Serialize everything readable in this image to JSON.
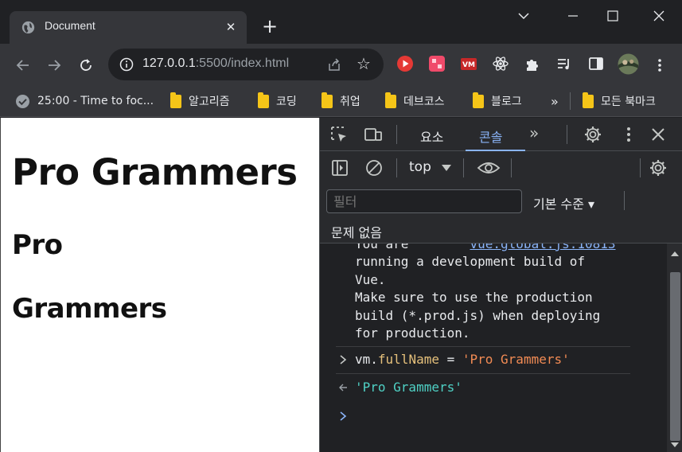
{
  "browser": {
    "tab": {
      "title": "Document"
    },
    "url": {
      "host": "127.0.0.1",
      "path": ":5500/index.html"
    },
    "bookmarks": [
      {
        "label": "25:00 - Time to foc...",
        "kind": "site"
      },
      {
        "label": "알고리즘",
        "kind": "folder"
      },
      {
        "label": "코딩",
        "kind": "folder"
      },
      {
        "label": "취업",
        "kind": "folder"
      },
      {
        "label": "데브코스",
        "kind": "folder"
      },
      {
        "label": "블로그",
        "kind": "folder"
      }
    ],
    "bookmarks_overflow": "»",
    "all_bookmarks": "모든 북마크"
  },
  "page": {
    "h1": "Pro Grammers",
    "h2_first": "Pro",
    "h2_second": "Grammers"
  },
  "devtools": {
    "tabs": {
      "elements": "요소",
      "console": "콘솔",
      "more": "»"
    },
    "toolbar": {
      "context": "top"
    },
    "filter": {
      "placeholder": "필터"
    },
    "levels": "기본 수준 ▾",
    "issues": "문제 없음",
    "console": {
      "partial_top_text": "You are",
      "partial_top_link": "vue.global.js:10813",
      "message_lines": [
        "running a development build of",
        "Vue.",
        "Make sure to use the production",
        "build (*.prod.js) when deploying",
        "for production."
      ],
      "input": {
        "object": "vm.",
        "property": "fullName",
        "op": " = ",
        "value": "'Pro Grammers'"
      },
      "output": "'Pro Grammers'"
    }
  },
  "colors": {
    "accent": "#8ab4f8",
    "string": "#f28b54",
    "return": "#4fd1c5",
    "property": "#e5c07b"
  }
}
